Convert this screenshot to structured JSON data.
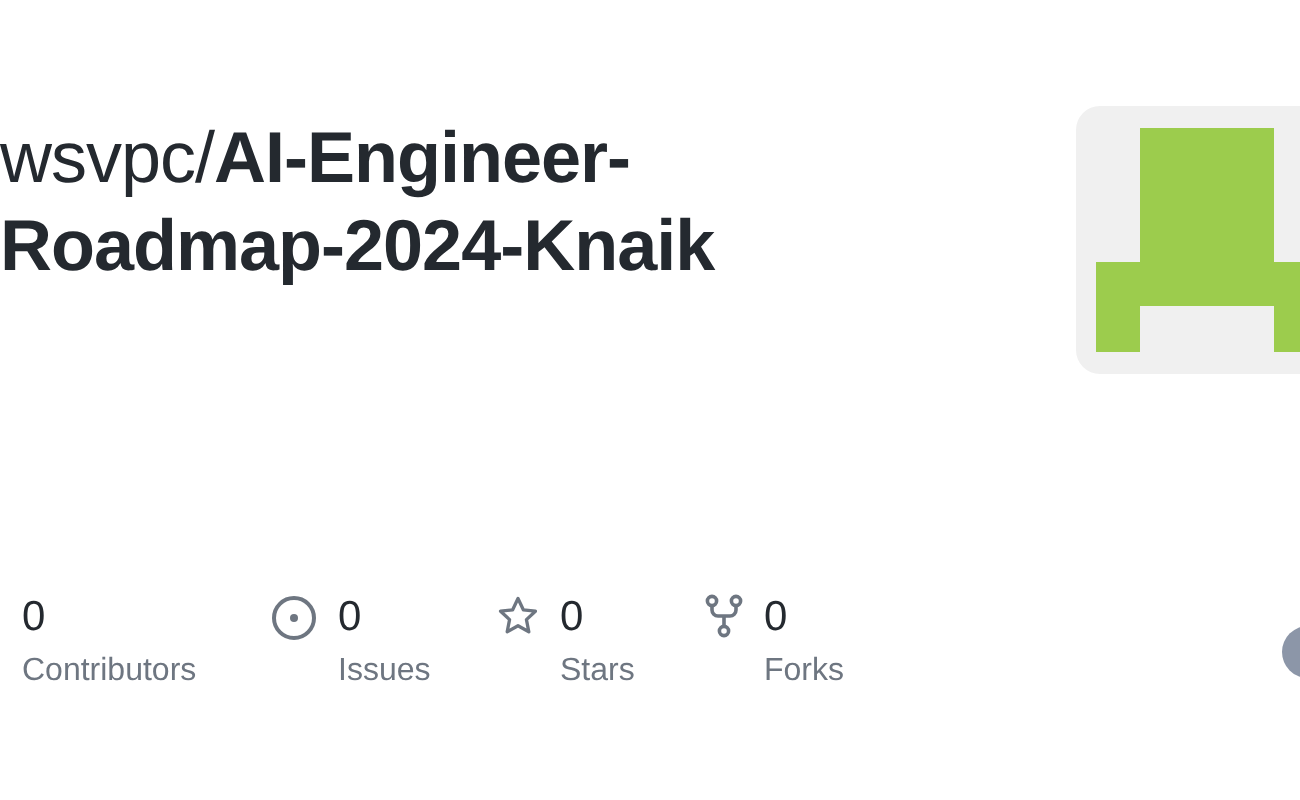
{
  "title": {
    "owner": "wsvpc/",
    "repo_line_1": "AI-Engineer-",
    "repo_line_2": "Roadmap-2024-Knaik"
  },
  "stats": [
    {
      "kind": "contributors",
      "value": "0",
      "label": "Contributors"
    },
    {
      "kind": "issues",
      "value": "0",
      "label": "Issues"
    },
    {
      "kind": "stars",
      "value": "0",
      "label": "Stars"
    },
    {
      "kind": "forks",
      "value": "0",
      "label": "Forks"
    }
  ]
}
